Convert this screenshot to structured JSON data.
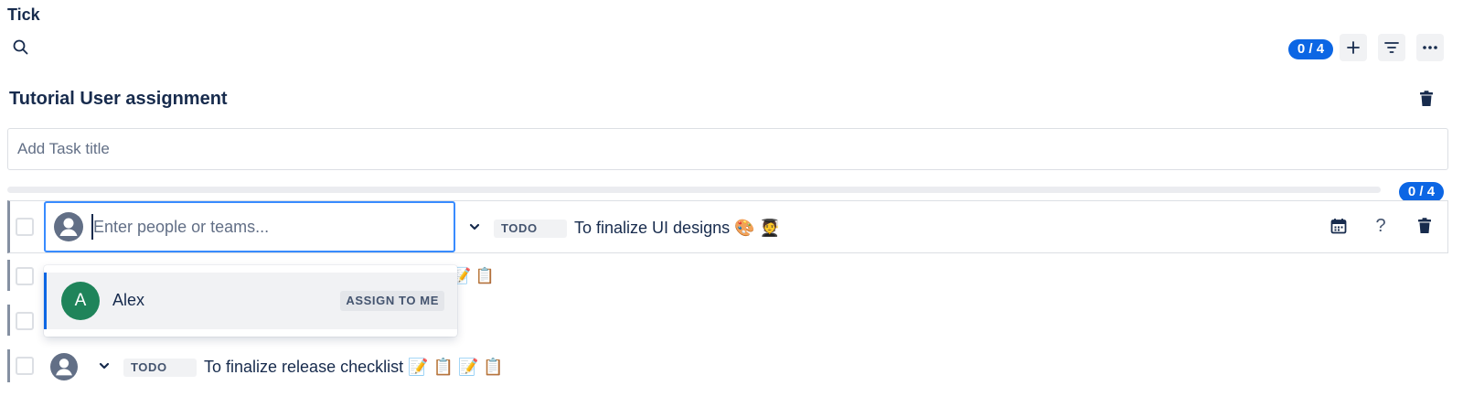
{
  "app": {
    "title": "Tick"
  },
  "header": {
    "count_badge": "0 / 4"
  },
  "list": {
    "title": "Tutorial User assignment",
    "add_task_placeholder": "Add Task title",
    "progress": {
      "badge": "0 / 4",
      "fraction": 0
    }
  },
  "assignee_picker": {
    "placeholder": "Enter people or teams...",
    "options": [
      {
        "initial": "A",
        "name": "Alex",
        "action": "ASSIGN TO ME"
      }
    ]
  },
  "tasks": [
    {
      "status": "TODO",
      "text": "To finalize UI designs",
      "emoji": "🎨 🧑‍🎓"
    },
    {
      "partial_emoji": "📝 📋"
    },
    {},
    {
      "status": "TODO",
      "text": "To finalize release checklist",
      "emoji": "📝 📋 📝 📋"
    }
  ],
  "colors": {
    "accent": "#0c66e4",
    "focus_border": "#388bff",
    "avatar_green": "#1f845a",
    "text": "#172b4d"
  },
  "icons": [
    "search-icon",
    "plus-icon",
    "filter-icon",
    "more-icon",
    "trash-icon",
    "calendar-icon",
    "help-icon",
    "chevron-down-icon",
    "user-avatar-icon"
  ]
}
